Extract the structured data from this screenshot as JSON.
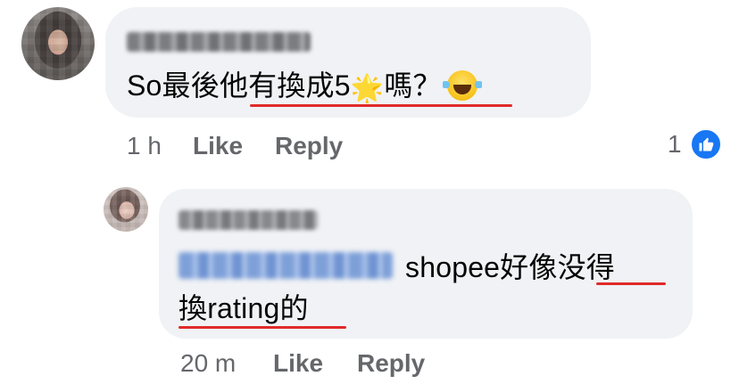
{
  "comment": {
    "author_blurred": true,
    "text_pre": "So最後",
    "text_underlined": "他有換成5",
    "star_emoji": "🌟",
    "text_underlined_2": "嗎",
    "text_post": "？",
    "laugh_emoji_icon": "tears-of-joy-emoji",
    "time": "1 h",
    "like_label": "Like",
    "reply_label": "Reply",
    "reaction_count": "1",
    "reaction_icon": "thumbs-up-icon"
  },
  "reply": {
    "author_blurred": true,
    "mention_blurred": true,
    "line1_text": "shopee好像",
    "line1_underlined": "没得",
    "line2_text": "換rating的",
    "time": "20 m",
    "like_label": "Like",
    "reply_label": "Reply"
  },
  "colors": {
    "bubble": "#f0f2f5",
    "meta_text": "#65676b",
    "like_blue": "#1877f2",
    "spellcheck_red": "#e02a2a"
  }
}
